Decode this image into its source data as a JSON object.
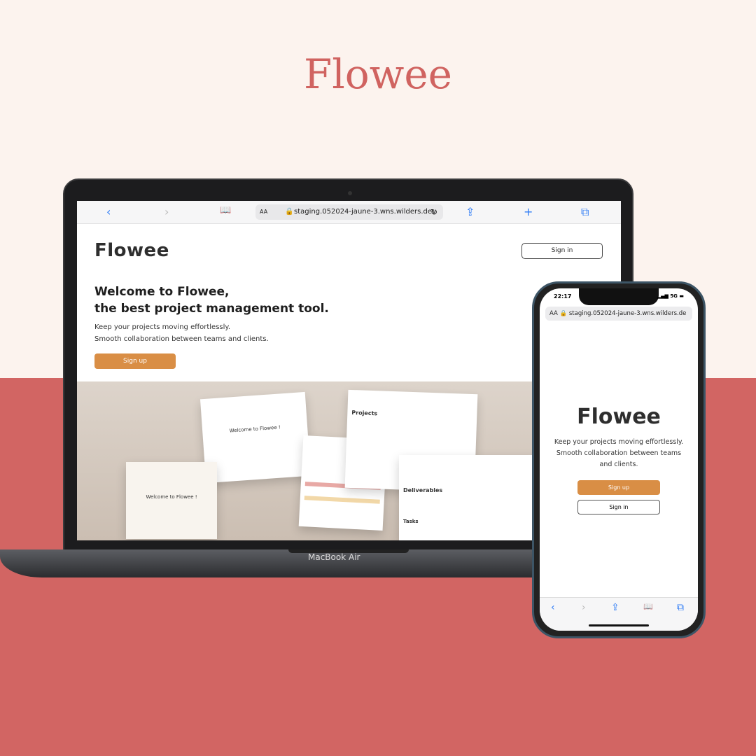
{
  "title": "Flowee",
  "colors": {
    "top_bg": "#fcf3ee",
    "bottom_bg": "#d26563",
    "title": "#d06360",
    "accent": "#d98e45",
    "logo_blue": "#4b6ad6"
  },
  "laptop": {
    "model_label": "MacBook Air",
    "browser": {
      "url": "staging.052024-jaune-3.wns.wilders.dev",
      "text_size": "AA",
      "icons": [
        "chevron-left-icon",
        "chevron-right-icon",
        "book-icon",
        "lock-icon",
        "reload-icon",
        "share-icon",
        "plus-icon",
        "tabs-icon"
      ]
    },
    "page": {
      "logo": "Flowee",
      "sign_in": "Sign in",
      "heading_line1": "Welcome to Flowee,",
      "heading_line2": "the best project management tool.",
      "text_line1": "Keep your projects moving effortlessly.",
      "text_line2": "Smooth collaboration between teams and clients.",
      "sign_up": "Sign up",
      "hero_cards": {
        "welcome": "Welcome to Flowee !",
        "projects": "Projects",
        "deliverables": "Deliverables",
        "tasks": "Tasks"
      }
    }
  },
  "phone": {
    "time": "22:17",
    "network": "5G",
    "url": "staging.052024-jaune-3.wns.wilders.de",
    "text_size": "AA",
    "logo": "Flowee",
    "text": "Keep your projects moving effortlessly. Smooth collaboration between teams and clients.",
    "sign_up": "Sign up",
    "sign_in": "Sign in"
  }
}
